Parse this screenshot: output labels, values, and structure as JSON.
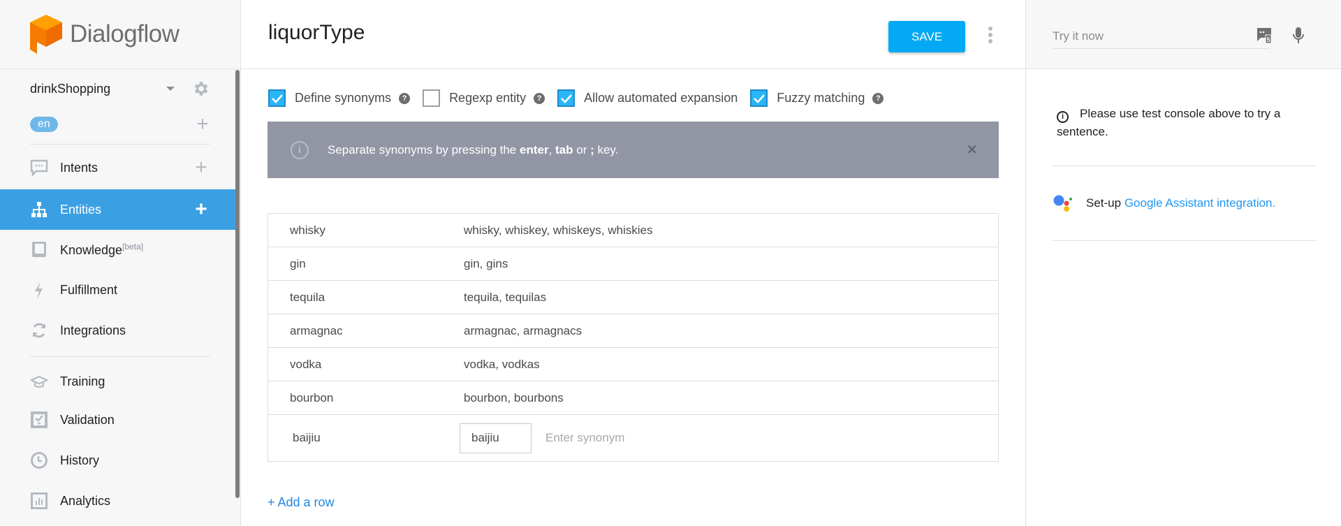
{
  "app": {
    "name": "Dialogflow"
  },
  "sidebar": {
    "agent_name": "drinkShopping",
    "language": "en",
    "items": [
      {
        "label": "Intents",
        "icon": "chat-bubble-icon",
        "has_add": true,
        "active": false
      },
      {
        "label": "Entities",
        "icon": "sitemap-icon",
        "has_add": true,
        "active": true
      },
      {
        "label": "Knowledge",
        "badge": "[beta]",
        "icon": "book-icon",
        "has_add": false,
        "active": false
      },
      {
        "label": "Fulfillment",
        "icon": "lightning-icon",
        "has_add": false,
        "active": false
      },
      {
        "label": "Integrations",
        "icon": "refresh-icon",
        "has_add": false,
        "active": false
      },
      {
        "label": "Training",
        "icon": "graduation-cap-icon",
        "has_add": false,
        "active": false
      },
      {
        "label": "Validation",
        "icon": "check-box-icon",
        "has_add": false,
        "active": false
      },
      {
        "label": "History",
        "icon": "clock-icon",
        "has_add": false,
        "active": false
      },
      {
        "label": "Analytics",
        "icon": "bar-chart-icon",
        "has_add": false,
        "active": false
      }
    ]
  },
  "main": {
    "entity_name": "liquorType",
    "save_label": "SAVE",
    "options": [
      {
        "label": "Define synonyms",
        "checked": true,
        "help": true
      },
      {
        "label": "Regexp entity",
        "checked": false,
        "help": true
      },
      {
        "label": "Allow automated expansion",
        "checked": true,
        "help": false
      },
      {
        "label": "Fuzzy matching",
        "checked": true,
        "help": true
      }
    ],
    "info_banner": {
      "prefix": "Separate synonyms by pressing the ",
      "key1": "enter",
      "sep": ", ",
      "key2": "tab",
      "mid": " or ",
      "key3": ";",
      "suffix": " key."
    },
    "entries": [
      {
        "reference": "whisky",
        "synonyms": "whisky, whiskey, whiskeys, whiskies"
      },
      {
        "reference": "gin",
        "synonyms": "gin, gins"
      },
      {
        "reference": "tequila",
        "synonyms": "tequila, tequilas"
      },
      {
        "reference": "armagnac",
        "synonyms": "armagnac, armagnacs"
      },
      {
        "reference": "vodka",
        "synonyms": "vodka, vodkas"
      },
      {
        "reference": "bourbon",
        "synonyms": "bourbon, bourbons"
      }
    ],
    "editing_row": {
      "reference": "baijiu",
      "synonym_chip": "baijiu",
      "synonym_placeholder": "Enter synonym"
    },
    "add_row_label": "+ Add a row"
  },
  "right_panel": {
    "try_placeholder": "Try it now",
    "hint": "Please use test console above to try a sentence.",
    "ga_prefix": "Set-up ",
    "ga_link": "Google Assistant integration."
  },
  "colors": {
    "accent": "#03a9f4",
    "active_nav": "#3ba0e3",
    "banner_bg": "#9296a4",
    "link": "#1e88e5",
    "logo_orange": "#ff9800"
  }
}
